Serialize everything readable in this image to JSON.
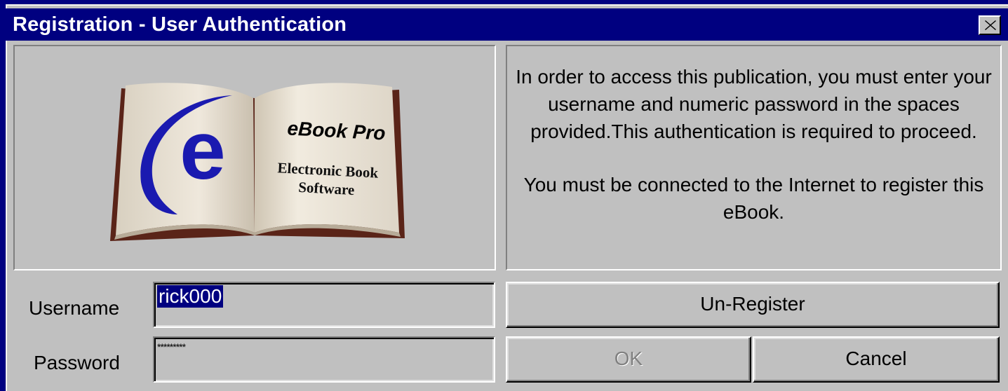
{
  "window": {
    "title": "Registration - User Authentication",
    "close_label": "✕"
  },
  "logo": {
    "brand": "eBook Pro",
    "tagline_line1": "Electronic Book",
    "tagline_line2": "Software",
    "letter": "e"
  },
  "info": {
    "paragraph1": "In order to access this publication, you must enter your username and numeric password in the spaces provided.This authentication is required to proceed.",
    "paragraph2": "You must be connected to the Internet to register this eBook."
  },
  "form": {
    "username_label": "Username",
    "username_value": "rick000",
    "password_label": "Password",
    "password_value": "*********"
  },
  "buttons": {
    "unregister": "Un-Register",
    "ok": "OK",
    "cancel": "Cancel"
  },
  "colors": {
    "titlebar": "#000080",
    "face": "#c0c0c0",
    "selection": "#000080",
    "logo_blue": "#1a1ab0"
  }
}
